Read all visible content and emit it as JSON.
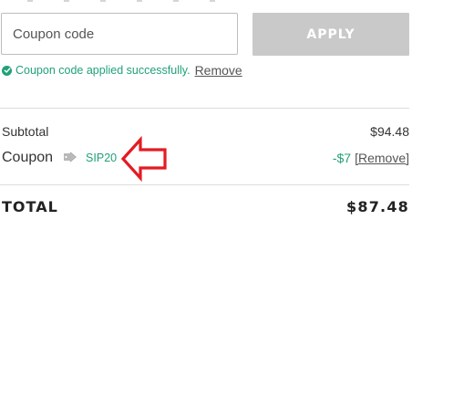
{
  "coupon_form": {
    "input_placeholder": "Coupon code",
    "input_value": "",
    "apply_label": "APPLY",
    "success_message": "Coupon code applied successfully.",
    "remove_label": "Remove"
  },
  "summary": {
    "subtotal_label": "Subtotal",
    "subtotal_value": "$94.48",
    "coupon_label": "Coupon",
    "coupon_code": "SIP20",
    "coupon_icon": "tag-icon",
    "coupon_discount": "-$7",
    "coupon_remove": "[Remove]",
    "total_label": "TOTAL",
    "total_value": "$87.48"
  },
  "colors": {
    "accent_green": "#21a179",
    "apply_disabled": "#c9c9c9",
    "annotation_red": "#e31b23"
  }
}
